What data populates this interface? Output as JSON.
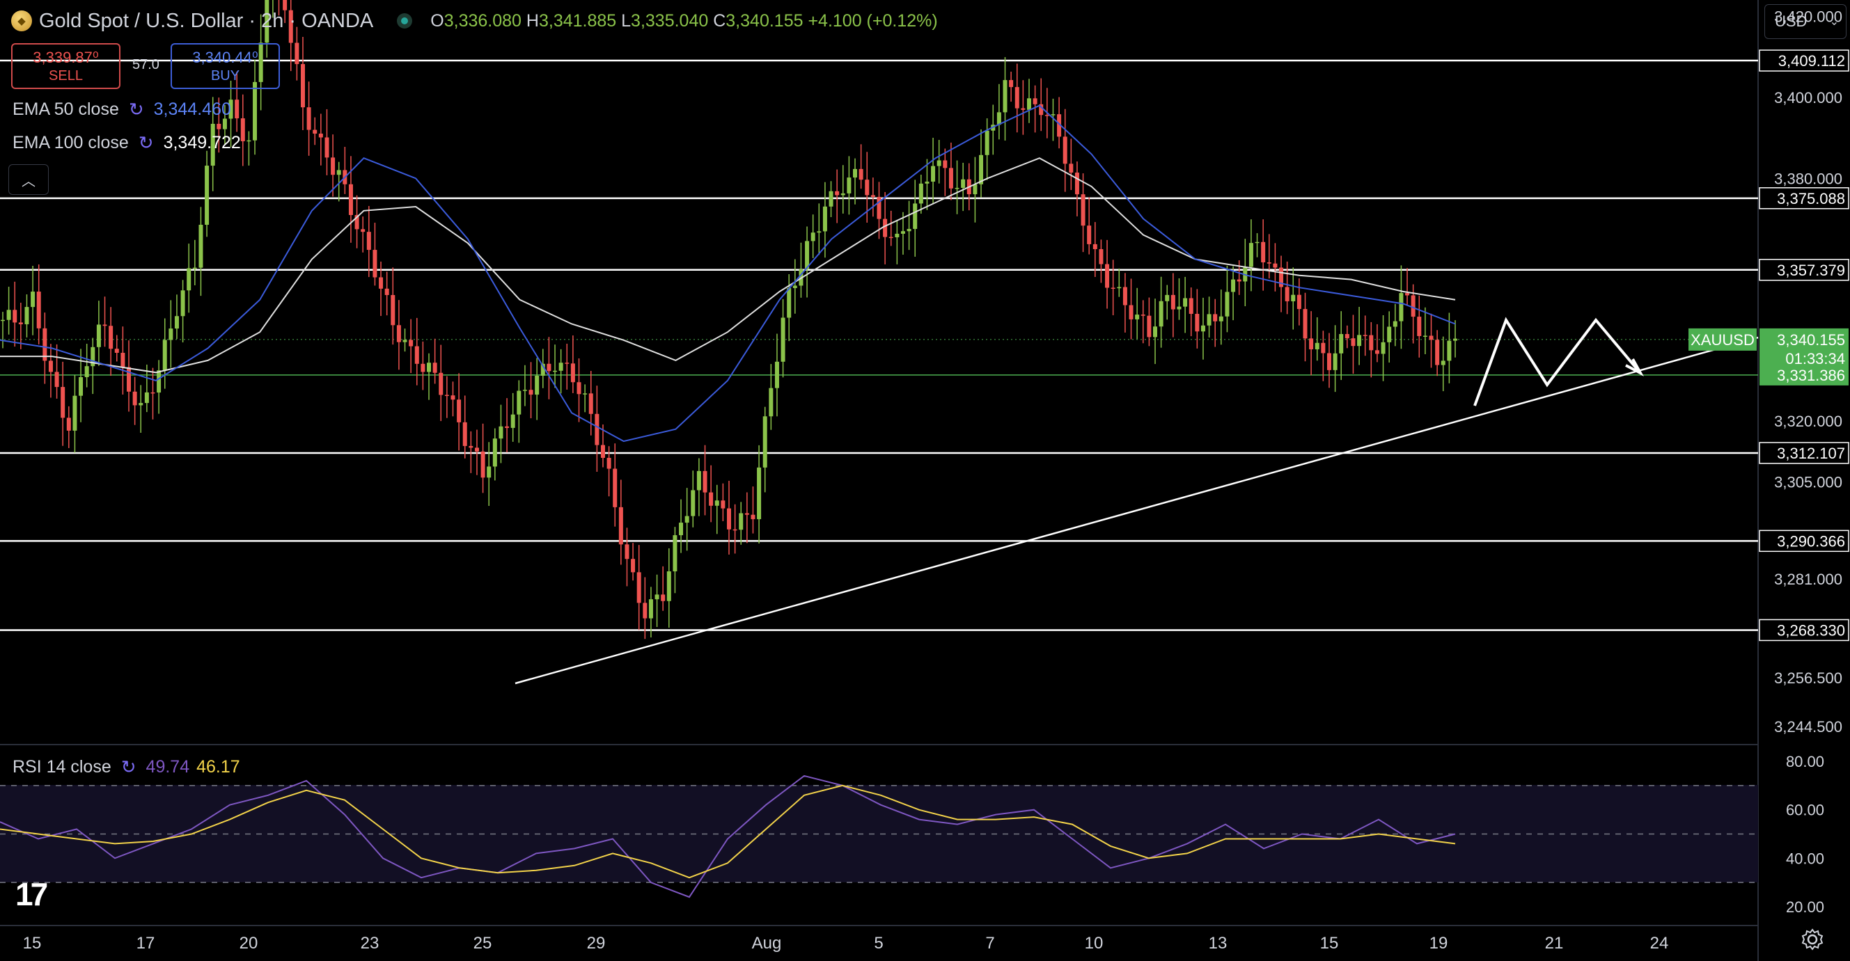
{
  "header": {
    "symbol_title": "Gold Spot / U.S. Dollar · 2h · OANDA",
    "open_label": "O",
    "open": "3,336.080",
    "high_label": "H",
    "high": "3,341.885",
    "low_label": "L",
    "low": "3,335.040",
    "close_label": "C",
    "close": "3,340.155",
    "change": "+4.100 (+0.12%)"
  },
  "trade": {
    "sell_price": "3,339.87⁰",
    "sell_label": "SELL",
    "spread": "57.0",
    "buy_price": "3,340.44⁰",
    "buy_label": "BUY"
  },
  "indicators": {
    "ema50_label": "EMA 50 close",
    "ema50_value": "3,344.460",
    "ema100_label": "EMA 100 close",
    "ema100_value": "3,349.722",
    "rsi_label": "RSI 14 close",
    "rsi_value": "49.74",
    "rsi_ma_value": "46.17"
  },
  "currency_selector": "USD",
  "colors": {
    "up": "#8bc34a",
    "down": "#ef5350",
    "ema50": "#3b5bdb",
    "ema100": "#e0e0e0",
    "rsi": "#7e57c2",
    "rsi_ma": "#f3d34a",
    "price_tag": "#4caf50"
  },
  "chart_data": {
    "type": "candlestick",
    "symbol": "XAUUSD",
    "last_price": "3,340.155",
    "countdown": "01:33:34",
    "price_axis_ticks": [
      "3,420.000",
      "3,400.000",
      "3,380.000",
      "3,305.000",
      "3,281.000",
      "3,320.000",
      "3,256.500",
      "3,244.500"
    ],
    "price_levels": [
      "3,409.112",
      "3,375.088",
      "3,357.379",
      "3,331.386",
      "3,312.107",
      "3,290.366",
      "3,268.330"
    ],
    "x_tick_labels": [
      "15",
      "17",
      "20",
      "23",
      "25",
      "29",
      "Aug",
      "5",
      "7",
      "10",
      "13",
      "15",
      "19",
      "21",
      "24"
    ],
    "rsi_ticks": [
      "80.00",
      "60.00",
      "40.00",
      "20.00"
    ],
    "rsi_levels": [
      70,
      50,
      30
    ],
    "ohlc_sample_y": [
      3345,
      3350,
      3330,
      3318,
      3336,
      3345,
      3332,
      3322,
      3332,
      3348,
      3360,
      3393,
      3397,
      3388,
      3427,
      3424,
      3398,
      3388,
      3380,
      3368,
      3358,
      3345,
      3337,
      3332,
      3326,
      3316,
      3308,
      3318,
      3325,
      3330,
      3334,
      3332,
      3322,
      3306,
      3284,
      3272,
      3278,
      3296,
      3306,
      3298,
      3293,
      3298,
      3330,
      3352,
      3362,
      3372,
      3378,
      3382,
      3370,
      3364,
      3372,
      3384,
      3380,
      3377,
      3390,
      3402,
      3397,
      3398,
      3392,
      3375,
      3360,
      3352,
      3347,
      3343,
      3351,
      3348,
      3342,
      3347,
      3357,
      3365,
      3356,
      3349,
      3338,
      3335,
      3342,
      3340,
      3337,
      3351,
      3343,
      3336,
      3340
    ],
    "ema50_sample": [
      3340,
      3338,
      3334,
      3330,
      3338,
      3350,
      3372,
      3385,
      3380,
      3365,
      3343,
      3322,
      3315,
      3318,
      3330,
      3350,
      3365,
      3375,
      3385,
      3392,
      3398,
      3386,
      3370,
      3360,
      3356,
      3353,
      3351,
      3349,
      3344
    ],
    "ema100_sample": [
      3336,
      3336,
      3334,
      3332,
      3335,
      3342,
      3360,
      3372,
      3373,
      3364,
      3350,
      3344,
      3340,
      3335,
      3342,
      3352,
      3360,
      3368,
      3374,
      3380,
      3385,
      3378,
      3366,
      3360,
      3358,
      3356,
      3355,
      3352,
      3350
    ],
    "rsi_sample": [
      55,
      48,
      52,
      40,
      46,
      52,
      62,
      66,
      72,
      58,
      40,
      32,
      36,
      34,
      42,
      44,
      48,
      30,
      24,
      48,
      62,
      74,
      70,
      62,
      56,
      54,
      58,
      60,
      48,
      36,
      40,
      46,
      54,
      44,
      50,
      48,
      56,
      46,
      50
    ],
    "rsi_ma_sample": [
      52,
      50,
      48,
      46,
      47,
      50,
      56,
      63,
      68,
      64,
      52,
      40,
      36,
      34,
      35,
      37,
      42,
      38,
      32,
      38,
      52,
      66,
      70,
      66,
      60,
      56,
      56,
      57,
      54,
      45,
      40,
      42,
      48,
      48,
      48,
      48,
      50,
      48,
      46
    ]
  }
}
